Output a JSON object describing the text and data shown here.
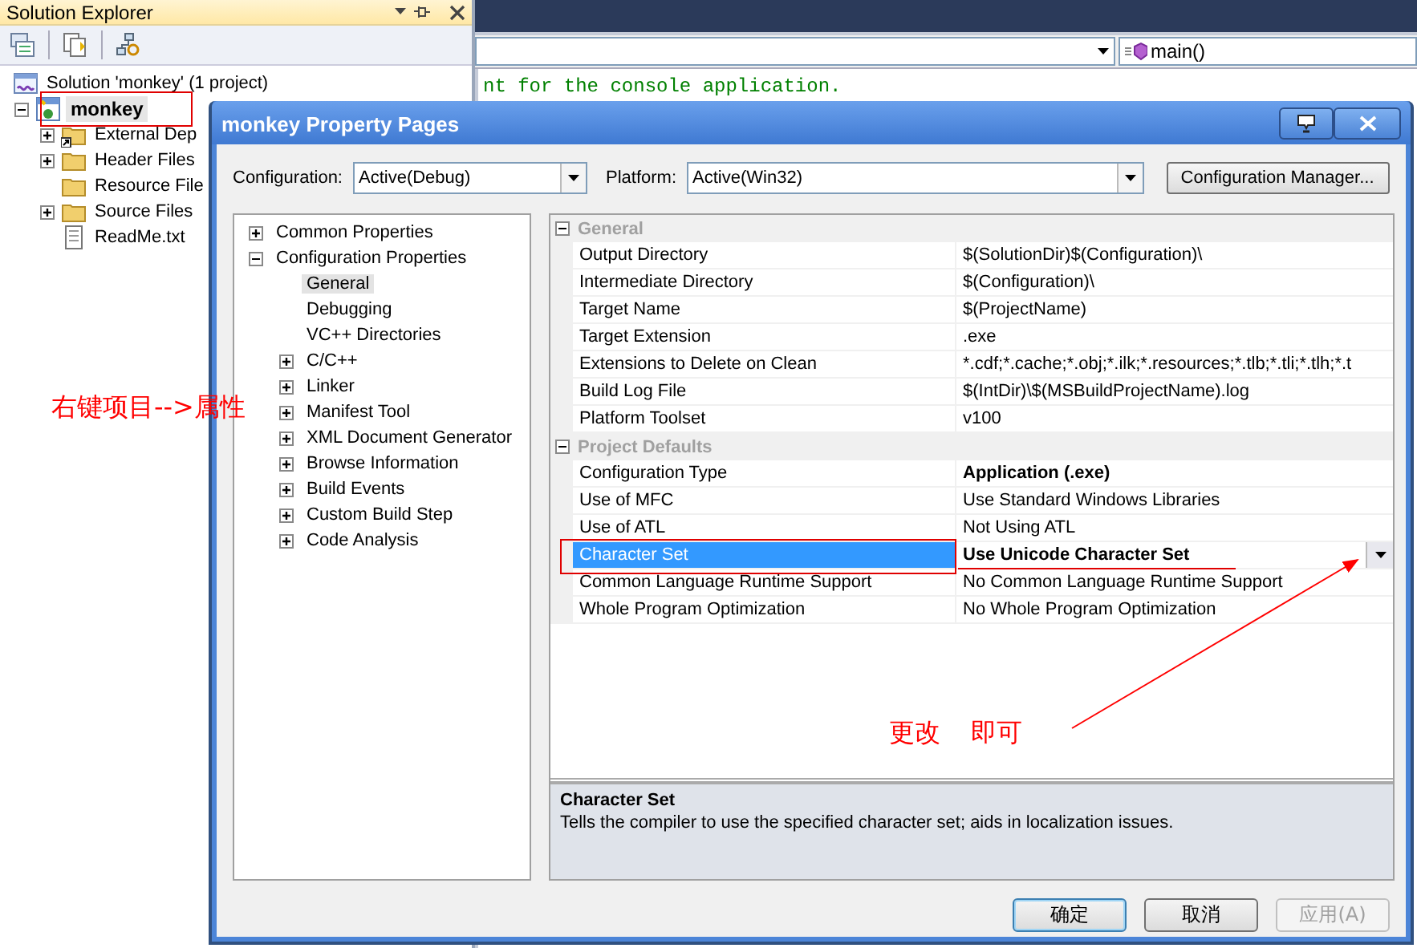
{
  "solution_explorer": {
    "title": "Solution Explorer",
    "tree": [
      {
        "label": "Solution 'monkey' (1 project)",
        "kind": "solution",
        "selected": false,
        "children": [
          {
            "label": "monkey",
            "kind": "project",
            "expanded": true,
            "selected": true,
            "children": [
              {
                "label": "External Dep",
                "kind": "linked-folder",
                "expanded": false,
                "selected": false
              },
              {
                "label": "Header Files",
                "kind": "folder",
                "expanded": false,
                "selected": false
              },
              {
                "label": "Resource File",
                "kind": "folder",
                "selected": false
              },
              {
                "label": "Source Files",
                "kind": "folder",
                "expanded": false,
                "selected": false
              },
              {
                "label": "ReadMe.txt",
                "kind": "file",
                "selected": false
              }
            ]
          }
        ]
      }
    ]
  },
  "editor": {
    "function_combo": "main()",
    "code_lines": [
      "nt for the console application."
    ]
  },
  "dialog": {
    "title": "monkey Property Pages",
    "configuration_label": "Configuration:",
    "configuration": "Active(Debug)",
    "platform_label": "Platform:",
    "platform": "Active(Win32)",
    "manager_button": "Configuration Manager...",
    "tree": [
      {
        "label": "Common Properties",
        "expanded": false,
        "selected": false
      },
      {
        "label": "Configuration Properties",
        "expanded": true,
        "selected": false,
        "children": [
          {
            "label": "General",
            "selected": true
          },
          {
            "label": "Debugging",
            "selected": false
          },
          {
            "label": "VC++ Directories",
            "selected": false
          },
          {
            "label": "C/C++",
            "expanded": false,
            "selected": false
          },
          {
            "label": "Linker",
            "expanded": false,
            "selected": false
          },
          {
            "label": "Manifest Tool",
            "expanded": false,
            "selected": false
          },
          {
            "label": "XML Document Generator",
            "expanded": false,
            "selected": false
          },
          {
            "label": "Browse Information",
            "expanded": false,
            "selected": false
          },
          {
            "label": "Build Events",
            "expanded": false,
            "selected": false
          },
          {
            "label": "Custom Build Step",
            "expanded": false,
            "selected": false
          },
          {
            "label": "Code Analysis",
            "expanded": false,
            "selected": false
          }
        ]
      }
    ],
    "grid": [
      {
        "name": "General",
        "expanded": true,
        "rows": [
          {
            "name": "Output Directory",
            "value": "$(SolutionDir)$(Configuration)\\",
            "bold": false,
            "selected": false,
            "kind": "text"
          },
          {
            "name": "Intermediate Directory",
            "value": "$(Configuration)\\",
            "bold": false,
            "selected": false,
            "kind": "text"
          },
          {
            "name": "Target Name",
            "value": "$(ProjectName)",
            "bold": false,
            "selected": false,
            "kind": "text"
          },
          {
            "name": "Target Extension",
            "value": ".exe",
            "bold": false,
            "selected": false,
            "kind": "text"
          },
          {
            "name": "Extensions to Delete on Clean",
            "value": "*.cdf;*.cache;*.obj;*.ilk;*.resources;*.tlb;*.tli;*.tlh;*.t",
            "bold": false,
            "selected": false,
            "kind": "text"
          },
          {
            "name": "Build Log File",
            "value": "$(IntDir)\\$(MSBuildProjectName).log",
            "bold": false,
            "selected": false,
            "kind": "text"
          },
          {
            "name": "Platform Toolset",
            "value": "v100",
            "bold": false,
            "selected": false,
            "kind": "text"
          }
        ]
      },
      {
        "name": "Project Defaults",
        "expanded": true,
        "rows": [
          {
            "name": "Configuration Type",
            "value": "Application (.exe)",
            "bold": true,
            "selected": false,
            "kind": "text"
          },
          {
            "name": "Use of MFC",
            "value": "Use Standard Windows Libraries",
            "bold": false,
            "selected": false,
            "kind": "text"
          },
          {
            "name": "Use of ATL",
            "value": "Not Using ATL",
            "bold": false,
            "selected": false,
            "kind": "text"
          },
          {
            "name": "Character Set",
            "value": "Use Unicode Character Set",
            "bold": true,
            "selected": true,
            "kind": "dropdown"
          },
          {
            "name": "Common Language Runtime Support",
            "value": "No Common Language Runtime Support",
            "bold": false,
            "selected": false,
            "kind": "text"
          },
          {
            "name": "Whole Program Optimization",
            "value": "No Whole Program Optimization",
            "bold": false,
            "selected": false,
            "kind": "text"
          }
        ]
      }
    ],
    "description": {
      "title": "Character Set",
      "text": "Tells the compiler to use the specified character set; aids in localization issues."
    },
    "buttons": [
      {
        "label": "确定",
        "disabled": false,
        "default": true
      },
      {
        "label": "取消",
        "disabled": false,
        "default": false
      },
      {
        "label": "应用(A)",
        "disabled": true,
        "default": false
      }
    ]
  },
  "annotations": {
    "side_note": "右键项目-->属性",
    "change_note": "更改 即可"
  }
}
